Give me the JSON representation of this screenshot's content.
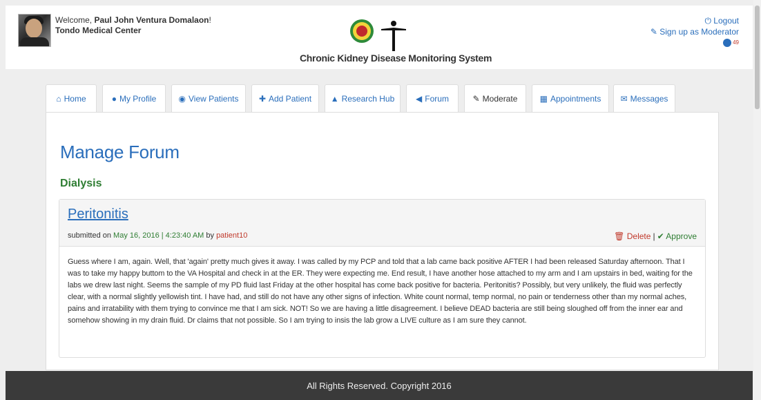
{
  "header": {
    "welcome_prefix": "Welcome, ",
    "user_name": "Paul John Ventura Domalaon",
    "welcome_suffix": "!",
    "organization": "Tondo Medical Center",
    "system_title": "Chronic Kidney Disease Monitoring System",
    "logout_label": "Logout",
    "signup_label": "Sign up as Moderator",
    "globe_count": "49"
  },
  "tabs": [
    {
      "label": "Home",
      "icon": "home-icon"
    },
    {
      "label": "My Profile",
      "icon": "user-icon"
    },
    {
      "label": "View Patients",
      "icon": "eye-icon"
    },
    {
      "label": "Add Patient",
      "icon": "plus-icon"
    },
    {
      "label": "Research Hub",
      "icon": "graduation-cap-icon"
    },
    {
      "label": "Forum",
      "icon": "megaphone-icon"
    },
    {
      "label": "Moderate",
      "icon": "pencil-icon",
      "active": true
    },
    {
      "label": "Appointments",
      "icon": "calendar-icon"
    },
    {
      "label": "Messages",
      "icon": "envelope-icon"
    }
  ],
  "main": {
    "page_title": "Manage Forum",
    "section_title": "Dialysis"
  },
  "post": {
    "title": "Peritonitis",
    "submitted_prefix": "submitted on ",
    "date": "May 16, 2016 | 4:23:40 AM",
    "by": " by ",
    "author": "patient10",
    "delete_label": "Delete",
    "separator": "|",
    "approve_label": "Approve",
    "body": "Guess where I am, again. Well, that 'again' pretty much gives it away. I was called by my PCP and told that a lab came back positive AFTER I had been released Saturday afternoon. That I was to take my happy buttom to the VA Hospital and check in at the ER. They were expecting me. End result, I have another hose attached to my arm and I am upstairs in bed, waiting for the labs we drew last night. Seems the sample of my PD fluid last Friday at the other hospital has come back positive for bacteria. Peritonitis? Possibly, but very unlikely, the fluid was perfectly clear, with a normal slightly yellowish tint. I have had, and still do not have any other signs of infection. White count normal, temp normal, no pain or tenderness other than my normal aches, pains and irratability with them trying to convince me that I am sick. NOT! So we are having a little disagreement. I believe DEAD bacteria are still being sloughed off from the inner ear and somehow showing in my drain fluid. Dr claims that not possible. So I am trying to insis the lab grow a LIVE culture as I am sure they cannot."
  },
  "footer": {
    "copyright": "All Rights Reserved. Copyright 2016"
  },
  "colors": {
    "link": "#2a6ebb",
    "green": "#2e7d32",
    "red": "#c0392b",
    "footer_bg": "#3a3a3a"
  }
}
